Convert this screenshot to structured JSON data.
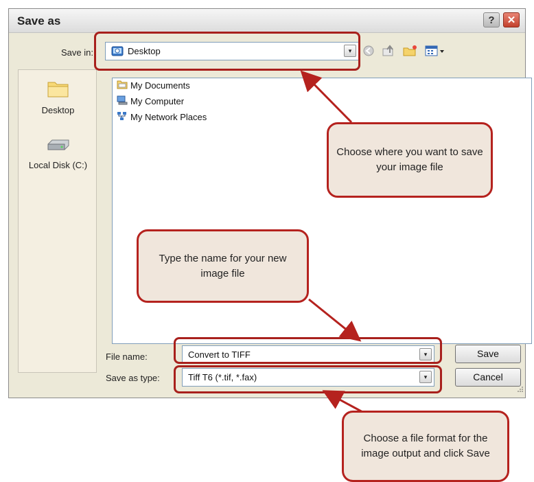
{
  "dialog": {
    "title": "Save as",
    "help_glyph": "?",
    "close_glyph": "✕"
  },
  "save_in": {
    "label": "Save in:",
    "value": "Desktop",
    "dropdown_glyph": "▾"
  },
  "toolbar": {
    "icons": [
      "back-icon",
      "up-folder-icon",
      "new-folder-icon",
      "views-menu-icon"
    ]
  },
  "places_bar": {
    "items": [
      {
        "label": "Desktop",
        "icon": "desktop-folder-icon"
      },
      {
        "label": "Local Disk (C:)",
        "icon": "disk-drive-icon"
      }
    ]
  },
  "file_list": {
    "items": [
      {
        "label": "My Documents",
        "icon": "folder-icon"
      },
      {
        "label": "My Computer",
        "icon": "computer-icon"
      },
      {
        "label": "My Network Places",
        "icon": "network-icon"
      }
    ]
  },
  "file_name": {
    "label": "File name:",
    "value": "Convert to  TIFF"
  },
  "save_as_type": {
    "label": "Save as type:",
    "value": "Tiff T6 (*.tif, *.fax)"
  },
  "buttons": {
    "save": "Save",
    "cancel": "Cancel"
  },
  "callouts": {
    "location": "Choose where you want to save your image file",
    "name": "Type the name for your new image file",
    "format": "Choose a file format for the image output and click Save"
  },
  "colors": {
    "callout_border": "#b5221e",
    "callout_fill": "#f0e6dc",
    "highlight": "#a8201c",
    "dialog_bg": "#ece9d8"
  }
}
